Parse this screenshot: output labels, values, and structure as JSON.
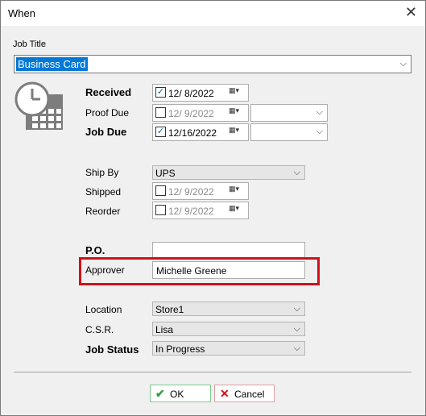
{
  "window": {
    "title": "When",
    "close_glyph": "✕"
  },
  "job_title": {
    "label": "Job Title",
    "value": "Business Card"
  },
  "dates": {
    "received": {
      "label": "Received",
      "checked": true,
      "value": "12/  8/2022"
    },
    "proof_due": {
      "label": "Proof Due",
      "checked": false,
      "value": "12/  9/2022",
      "time": ""
    },
    "job_due": {
      "label": "Job Due",
      "checked": true,
      "value": "12/16/2022",
      "time": ""
    }
  },
  "shipping": {
    "ship_by": {
      "label": "Ship By",
      "value": "UPS"
    },
    "shipped": {
      "label": "Shipped",
      "checked": false,
      "value": "12/  9/2022"
    },
    "reorder": {
      "label": "Reorder",
      "checked": false,
      "value": "12/  9/2022"
    }
  },
  "po": {
    "label": "P.O.",
    "value": ""
  },
  "approver": {
    "label": "Approver",
    "value": "Michelle Greene"
  },
  "location": {
    "label": "Location",
    "value": "Store1"
  },
  "csr": {
    "label": "C.S.R.",
    "value": "Lisa"
  },
  "job_status": {
    "label": "Job Status",
    "value": "In Progress"
  },
  "buttons": {
    "ok": "OK",
    "cancel": "Cancel"
  },
  "colors": {
    "highlight": "#d0101a",
    "selection": "#0078d7",
    "ok_green": "#2ea043",
    "cancel_red": "#d0101a"
  },
  "icons": {
    "clock_calendar": "clock-calendar-icon",
    "check": "✓",
    "dropdown": "chevron-down-icon"
  }
}
